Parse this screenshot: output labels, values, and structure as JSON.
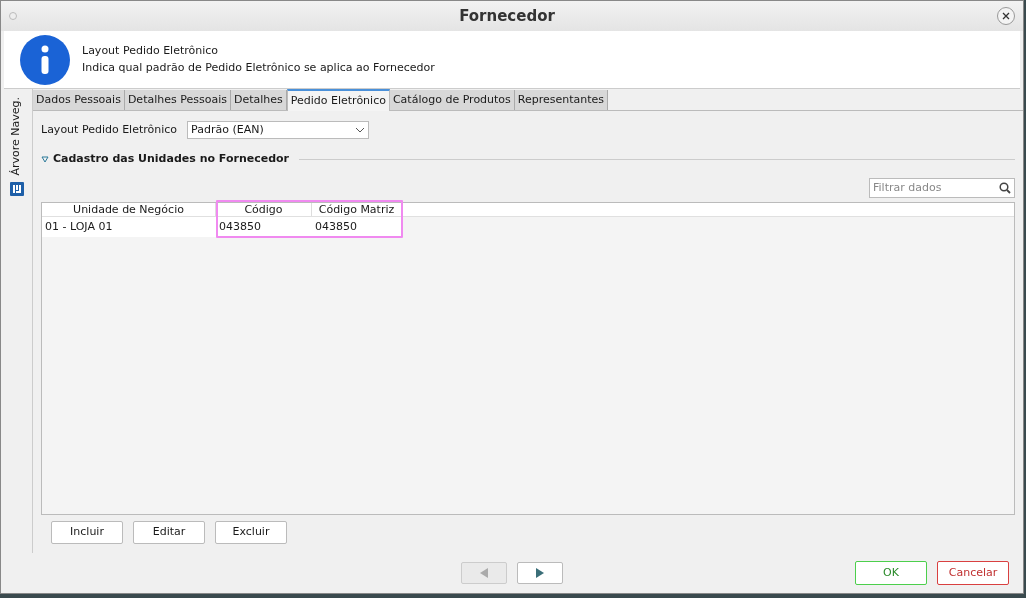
{
  "window": {
    "title": "Fornecedor"
  },
  "header": {
    "title": "Layout Pedido Eletrônico",
    "description": "Indica qual padrão de Pedido Eletrônico se aplica ao Fornecedor"
  },
  "side_panel": {
    "label": "Árvore Naveg."
  },
  "tabs": [
    {
      "label": "Dados Pessoais",
      "selected": false
    },
    {
      "label": "Detalhes Pessoais",
      "selected": false
    },
    {
      "label": "Detalhes",
      "selected": false
    },
    {
      "label": "Pedido Eletrônico",
      "selected": true
    },
    {
      "label": "Catálogo de Produtos",
      "selected": false
    },
    {
      "label": "Representantes",
      "selected": false
    }
  ],
  "layout_field": {
    "label": "Layout Pedido Eletrônico",
    "value": "Padrão (EAN)"
  },
  "section": {
    "title": "Cadastro das Unidades no Fornecedor",
    "expanded": true
  },
  "filter": {
    "placeholder": "Filtrar dados"
  },
  "table": {
    "columns": [
      "Unidade de Negócio",
      "Código",
      "Código Matriz"
    ],
    "rows": [
      [
        "01 - LOJA 01",
        "043850",
        "043850"
      ]
    ]
  },
  "table_buttons": [
    "Incluir",
    "Editar",
    "Excluir"
  ],
  "navigation": [
    {
      "kind": "back",
      "disabled": true
    },
    {
      "kind": "forward",
      "disabled": false
    }
  ],
  "dialog_buttons": [
    {
      "label": "OK",
      "kind": "confirm"
    },
    {
      "label": "Cancelar",
      "kind": "cancel"
    }
  ]
}
